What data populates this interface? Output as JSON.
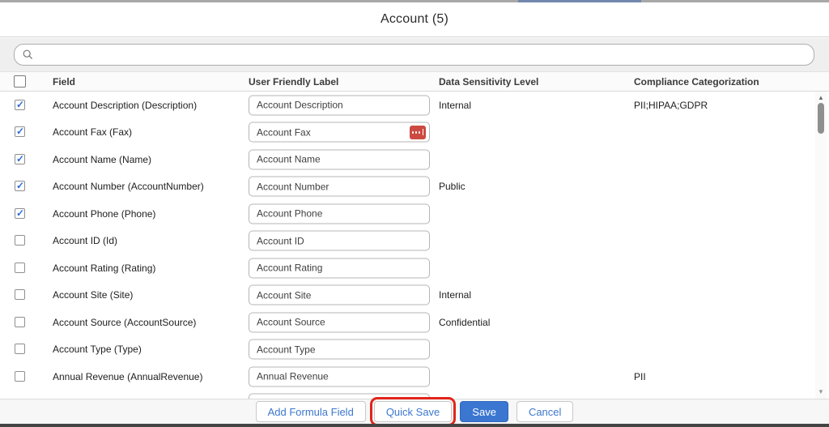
{
  "header": {
    "title": "Account (5)"
  },
  "search": {
    "placeholder": "",
    "value": ""
  },
  "table": {
    "select_all_checked": false,
    "columns": {
      "field": "Field",
      "user_friendly_label": "User Friendly Label",
      "data_sensitivity_level": "Data Sensitivity Level",
      "compliance_categorization": "Compliance Categorization"
    },
    "rows": [
      {
        "checked": true,
        "field": "Account Description (Description)",
        "label_value": "Account Description",
        "sensitivity": "Internal",
        "compliance": "PII;HIPAA;GDPR",
        "extension_icon": false
      },
      {
        "checked": true,
        "field": "Account Fax (Fax)",
        "label_value": "Account Fax",
        "sensitivity": "",
        "compliance": "",
        "extension_icon": true
      },
      {
        "checked": true,
        "field": "Account Name (Name)",
        "label_value": "Account Name",
        "sensitivity": "",
        "compliance": "",
        "extension_icon": false
      },
      {
        "checked": true,
        "field": "Account Number (AccountNumber)",
        "label_value": "Account Number",
        "sensitivity": "Public",
        "compliance": "",
        "extension_icon": false
      },
      {
        "checked": true,
        "field": "Account Phone (Phone)",
        "label_value": "Account Phone",
        "sensitivity": "",
        "compliance": "",
        "extension_icon": false
      },
      {
        "checked": false,
        "field": "Account ID (Id)",
        "label_value": "Account ID",
        "sensitivity": "",
        "compliance": "",
        "extension_icon": false
      },
      {
        "checked": false,
        "field": "Account Rating (Rating)",
        "label_value": "Account Rating",
        "sensitivity": "",
        "compliance": "",
        "extension_icon": false
      },
      {
        "checked": false,
        "field": "Account Site (Site)",
        "label_value": "Account Site",
        "sensitivity": "Internal",
        "compliance": "",
        "extension_icon": false
      },
      {
        "checked": false,
        "field": "Account Source (AccountSource)",
        "label_value": "Account Source",
        "sensitivity": "Confidential",
        "compliance": "",
        "extension_icon": false
      },
      {
        "checked": false,
        "field": "Account Type (Type)",
        "label_value": "Account Type",
        "sensitivity": "",
        "compliance": "",
        "extension_icon": false
      },
      {
        "checked": false,
        "field": "Annual Revenue (AnnualRevenue)",
        "label_value": "Annual Revenue",
        "sensitivity": "",
        "compliance": "PII",
        "extension_icon": false
      },
      {
        "checked": false,
        "field": "",
        "label_value": "",
        "sensitivity": "",
        "compliance": "",
        "extension_icon": false,
        "partially_visible": true
      }
    ]
  },
  "footer": {
    "buttons": [
      {
        "label": "Add Formula Field",
        "style": "neutral",
        "annotated": false
      },
      {
        "label": "Quick Save",
        "style": "neutral",
        "annotated": true
      },
      {
        "label": "Save",
        "style": "brand",
        "annotated": false
      },
      {
        "label": "Cancel",
        "style": "neutral",
        "annotated": false
      }
    ]
  },
  "colors": {
    "brand_button": "#3b76d1",
    "link_blue": "#3c77cd",
    "annotation_red": "#e1251b",
    "extension_icon_red": "#cc4a41",
    "search_band_bg": "#f0efef"
  }
}
